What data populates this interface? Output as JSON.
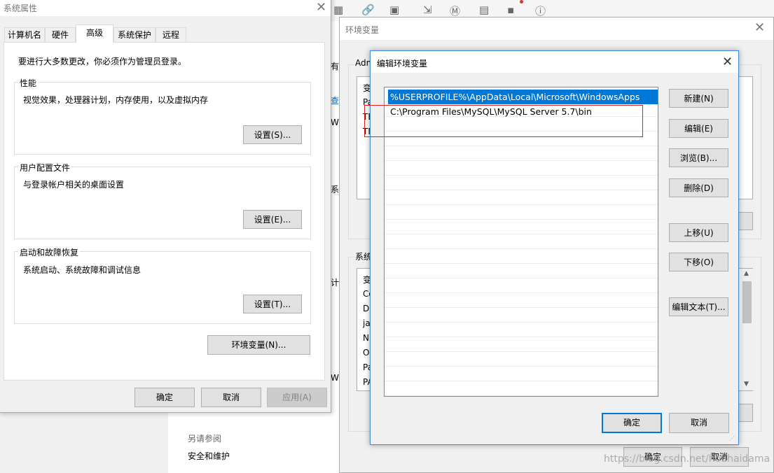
{
  "editor_toolbar": {
    "icons": [
      "table-icon",
      "link-icon",
      "image-icon",
      "import-icon",
      "markdown-icon",
      "book-icon",
      "save-icon",
      "help-icon"
    ]
  },
  "system_properties": {
    "title": "系统属性",
    "tabs": [
      "计算机名",
      "硬件",
      "高级",
      "系统保护",
      "远程"
    ],
    "active_tab": "高级",
    "admin_notice": "要进行大多数更改，你必须作为管理员登录。",
    "performance": {
      "title": "性能",
      "description": "视觉效果，处理器计划，内存使用，以及虚拟内存",
      "button": "设置(S)..."
    },
    "user_profile": {
      "title": "用户配置文件",
      "description": "与登录帐户相关的桌面设置",
      "button": "设置(E)..."
    },
    "startup_recovery": {
      "title": "启动和故障恢复",
      "description": "系统启动、系统故障和调试信息",
      "button": "设置(T)..."
    },
    "env_button": "环境变量(N)...",
    "ok": "确定",
    "cancel": "取消",
    "apply": "应用(A)"
  },
  "background_panel": {
    "partial_labels": [
      "有",
      "查看",
      "Win",
      "系统",
      "计算",
      "Win"
    ],
    "see_also": "另请参阅",
    "security": "安全和维护"
  },
  "env_vars": {
    "title": "环境变量",
    "user_group_partial": "Adm",
    "user_col_partial": "变",
    "user_rows_partial": [
      "Pa",
      "TE",
      "TM"
    ],
    "system_group_partial": "系统",
    "system_col_partial": "变",
    "system_rows_partial": [
      "Co",
      "Dr",
      "ja",
      "N",
      "O",
      "Pa",
      "PA"
    ],
    "ok": "确定",
    "cancel": "取消"
  },
  "edit_env": {
    "title": "编辑环境变量",
    "entries": [
      "%USERPROFILE%\\AppData\\Local\\Microsoft\\WindowsApps",
      "C:\\Program Files\\MySQL\\MySQL Server 5.7\\bin"
    ],
    "selected_index": 0,
    "buttons": {
      "new": "新建(N)",
      "edit": "编辑(E)",
      "browse": "浏览(B)...",
      "delete": "删除(D)",
      "move_up": "上移(U)",
      "move_down": "下移(O)",
      "edit_text": "编辑文本(T)..."
    },
    "ok": "确定",
    "cancel": "取消"
  },
  "watermark": "https://blog.csdn.net/houhaidama",
  "colors": {
    "selection": "#0078d7",
    "highlight_box": "#e02020",
    "dialog_border": "#3c8ad6"
  }
}
